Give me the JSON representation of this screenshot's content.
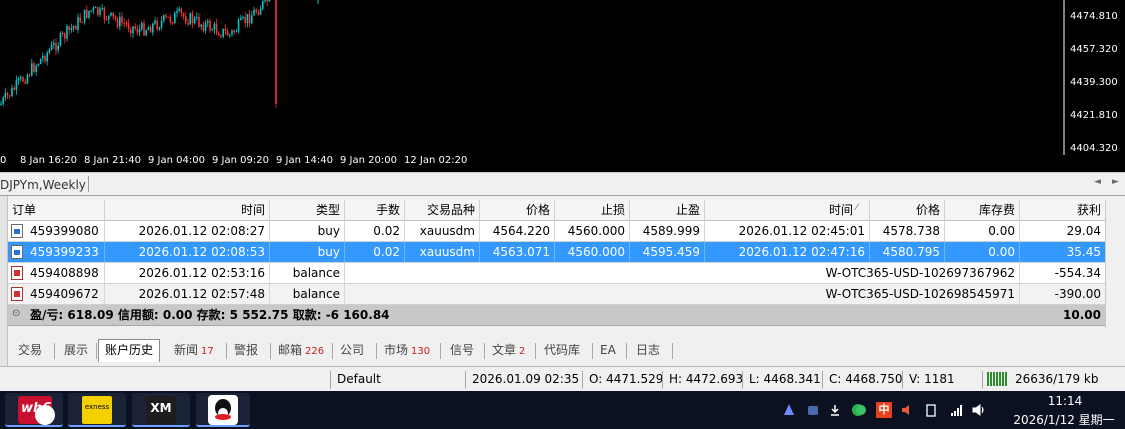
{
  "chart": {
    "price_ticks": [
      "4474.810",
      "4457.320",
      "4439.300",
      "4421.810",
      "4404.320"
    ],
    "time_ticks": [
      "0",
      "8 Jan 16:20",
      "8 Jan 21:40",
      "9 Jan 04:00",
      "9 Jan 09:20",
      "9 Jan 14:40",
      "9 Jan 20:00",
      "12 Jan 02:20"
    ],
    "up_color": "#00c8c8",
    "down_color": "#ff3030"
  },
  "chart_tabs": {
    "active": "DJPYm,Weekly"
  },
  "table": {
    "columns": [
      "订单",
      "时间",
      "类型",
      "手数",
      "交易品种",
      "价格",
      "止损",
      "止盈",
      "时间",
      "价格",
      "库存费",
      "获利"
    ],
    "rows": [
      {
        "order": "459399080",
        "open_time": "2026.01.12 02:08:27",
        "type": "buy",
        "lots": "0.02",
        "symbol": "xauusdm",
        "price": "4564.220",
        "sl": "4560.000",
        "tp": "4589.999",
        "close_time": "2026.01.12 02:45:01",
        "close_price": "4578.738",
        "swap": "0.00",
        "profit": "29.04"
      },
      {
        "order": "459399233",
        "open_time": "2026.01.12 02:08:53",
        "type": "buy",
        "lots": "0.02",
        "symbol": "xauusdm",
        "price": "4563.071",
        "sl": "4560.000",
        "tp": "4595.459",
        "close_time": "2026.01.12 02:47:16",
        "close_price": "4580.795",
        "swap": "0.00",
        "profit": "35.45"
      },
      {
        "order": "459408898",
        "open_time": "2026.01.12 02:53:16",
        "type": "balance",
        "comment": "W-OTC365-USD-102697367962",
        "profit": "-554.34"
      },
      {
        "order": "459409672",
        "open_time": "2026.01.12 02:57:48",
        "type": "balance",
        "comment": "W-OTC365-USD-102698545971",
        "profit": "-390.00"
      }
    ],
    "summary": {
      "pl_label": "盈/亏:",
      "pl_value": "618.09",
      "credit_label": "信用额:",
      "credit_value": "0.00",
      "deposit_label": "存款:",
      "deposit_value": "5 552.75",
      "withdraw_label": "取款:",
      "withdraw_value": "-6 160.84",
      "total": "10.00"
    }
  },
  "term_tabs": [
    {
      "label": "交易",
      "badge": ""
    },
    {
      "label": "展示",
      "badge": ""
    },
    {
      "label": "账户历史",
      "badge": ""
    },
    {
      "label": "新闻",
      "badge": "17"
    },
    {
      "label": "警报",
      "badge": ""
    },
    {
      "label": "邮箱",
      "badge": "226"
    },
    {
      "label": "公司",
      "badge": ""
    },
    {
      "label": "市场",
      "badge": "130"
    },
    {
      "label": "信号",
      "badge": ""
    },
    {
      "label": "文章",
      "badge": "2"
    },
    {
      "label": "代码库",
      "badge": ""
    },
    {
      "label": "EA",
      "badge": ""
    },
    {
      "label": "日志",
      "badge": ""
    }
  ],
  "status": {
    "profile": "Default",
    "datetime": "2026.01.09 02:35",
    "open": "O: 4471.529",
    "high": "H: 4472.693",
    "low": "L: 4468.341",
    "close": "C: 4468.750",
    "volume": "V: 1181",
    "traffic": "26636/179 kb"
  },
  "taskbar": {
    "apps": [
      "wh6",
      "exness",
      "XM",
      "qq-icon"
    ],
    "exness_label": "exness",
    "xm_label": "XM",
    "wh6_label": "wh6",
    "ime_label": "中",
    "time": "11:14",
    "date": "2026/1/12 星期一"
  }
}
